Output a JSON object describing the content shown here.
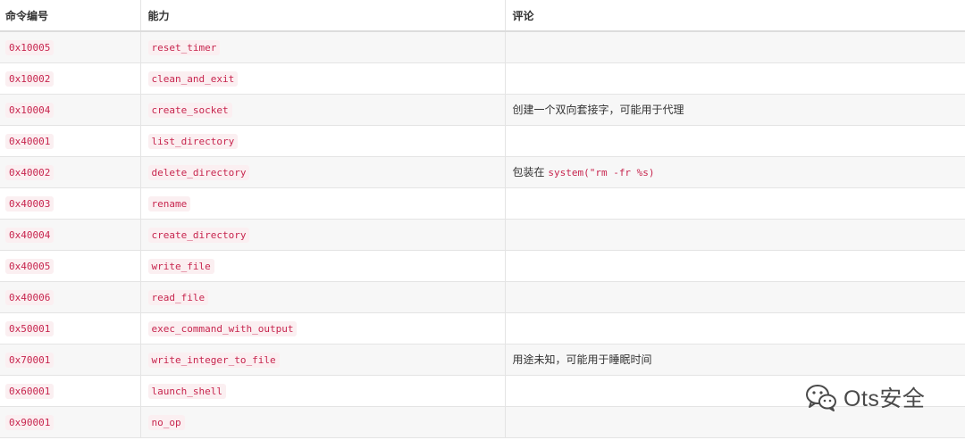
{
  "table": {
    "headers": [
      "命令编号",
      "能力",
      "评论"
    ],
    "rows": [
      {
        "id": "0x10005",
        "cap": "reset_timer",
        "comment": "",
        "comment_code": ""
      },
      {
        "id": "0x10002",
        "cap": "clean_and_exit",
        "comment": "",
        "comment_code": ""
      },
      {
        "id": "0x10004",
        "cap": "create_socket",
        "comment": "创建一个双向套接字，可能用于代理",
        "comment_code": ""
      },
      {
        "id": "0x40001",
        "cap": "list_directory",
        "comment": "",
        "comment_code": ""
      },
      {
        "id": "0x40002",
        "cap": "delete_directory",
        "comment": "包装在",
        "comment_code": "system(\"rm -fr %s)"
      },
      {
        "id": "0x40003",
        "cap": "rename",
        "comment": "",
        "comment_code": ""
      },
      {
        "id": "0x40004",
        "cap": "create_directory",
        "comment": "",
        "comment_code": ""
      },
      {
        "id": "0x40005",
        "cap": "write_file",
        "comment": "",
        "comment_code": ""
      },
      {
        "id": "0x40006",
        "cap": "read_file",
        "comment": "",
        "comment_code": ""
      },
      {
        "id": "0x50001",
        "cap": "exec_command_with_output",
        "comment": "",
        "comment_code": ""
      },
      {
        "id": "0x70001",
        "cap": "write_integer_to_file",
        "comment": "用途未知，可能用于睡眠时间",
        "comment_code": ""
      },
      {
        "id": "0x60001",
        "cap": "launch_shell",
        "comment": "",
        "comment_code": ""
      },
      {
        "id": "0x90001",
        "cap": "no_op",
        "comment": "",
        "comment_code": ""
      }
    ]
  },
  "watermark": {
    "icon": "wechat-icon",
    "text": "Ots安全"
  },
  "colors": {
    "code_text": "#c7254e",
    "code_bg": "#fbeff1",
    "row_alt": "#f7f7f7",
    "border": "#e4e4e4"
  }
}
